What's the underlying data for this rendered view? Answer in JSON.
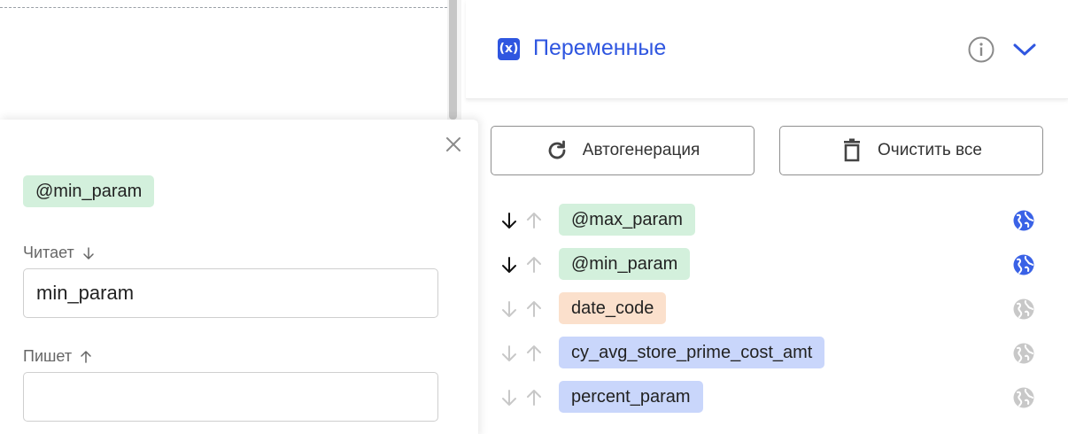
{
  "popup": {
    "variable_chip": "@min_param",
    "reads_label": "Читает",
    "reads_value": "min_param",
    "writes_label": "Пишет",
    "writes_value": ""
  },
  "header": {
    "icon_text": "(x)",
    "title": "Переменные"
  },
  "toolbar": {
    "autogen_label": "Автогенерация",
    "clear_label": "Очистить все"
  },
  "variables": [
    {
      "name": "@max_param",
      "color": "green",
      "down_active": true,
      "up_active": false,
      "global_active": true
    },
    {
      "name": "@min_param",
      "color": "green",
      "down_active": true,
      "up_active": false,
      "global_active": true
    },
    {
      "name": "date_code",
      "color": "orange",
      "down_active": false,
      "up_active": false,
      "global_active": false
    },
    {
      "name": "cy_avg_store_prime_cost_amt",
      "color": "blue",
      "down_active": false,
      "up_active": false,
      "global_active": false
    },
    {
      "name": "percent_param",
      "color": "blue",
      "down_active": false,
      "up_active": false,
      "global_active": false
    }
  ],
  "colors": {
    "accent": "#2f56e0",
    "chip_green": "#d3f0dc",
    "chip_orange": "#fbe0cc",
    "chip_blue": "#c9d6fb",
    "active_arrow": "#111111",
    "inactive_arrow": "#c8c8c8",
    "globe_active": "#3a62e6",
    "globe_inactive": "#c8c8c8"
  }
}
